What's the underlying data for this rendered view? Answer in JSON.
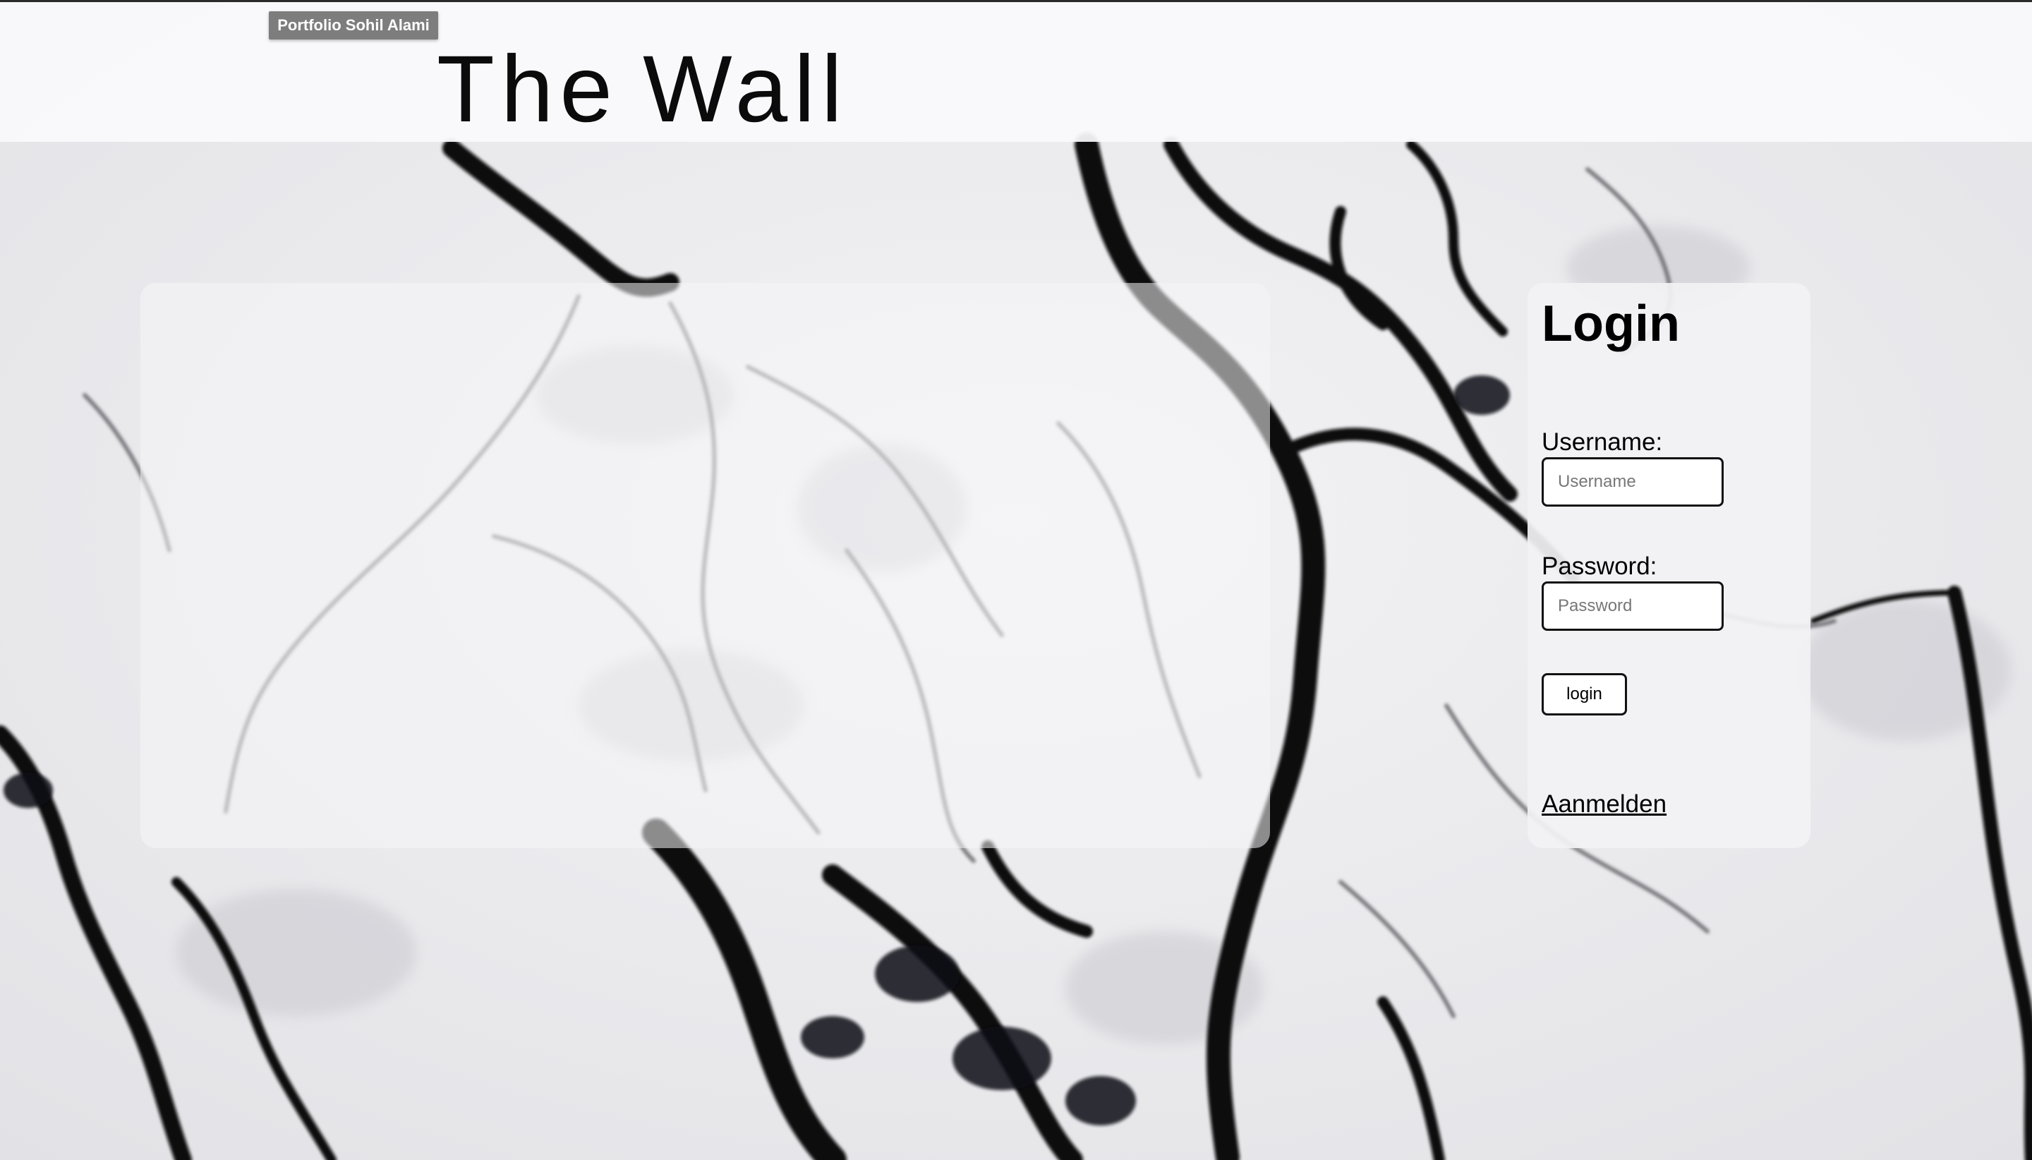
{
  "header": {
    "portfolio_button_label": "Portfolio Sohil Alami",
    "site_title": "The Wall"
  },
  "login": {
    "heading": "Login",
    "username_label": "Username:",
    "username_placeholder": "Username",
    "username_value": "",
    "password_label": "Password:",
    "password_placeholder": "Password",
    "password_value": "",
    "submit_label": "login",
    "signup_link_label": "Aanmelden"
  },
  "colors": {
    "header_background": "#fafafc",
    "button_background": "#7d7d7d",
    "button_text": "#ffffff",
    "text": "#000000",
    "marble_veins": "#0a0a0a"
  },
  "background": {
    "type": "black-and-white marble texture"
  }
}
